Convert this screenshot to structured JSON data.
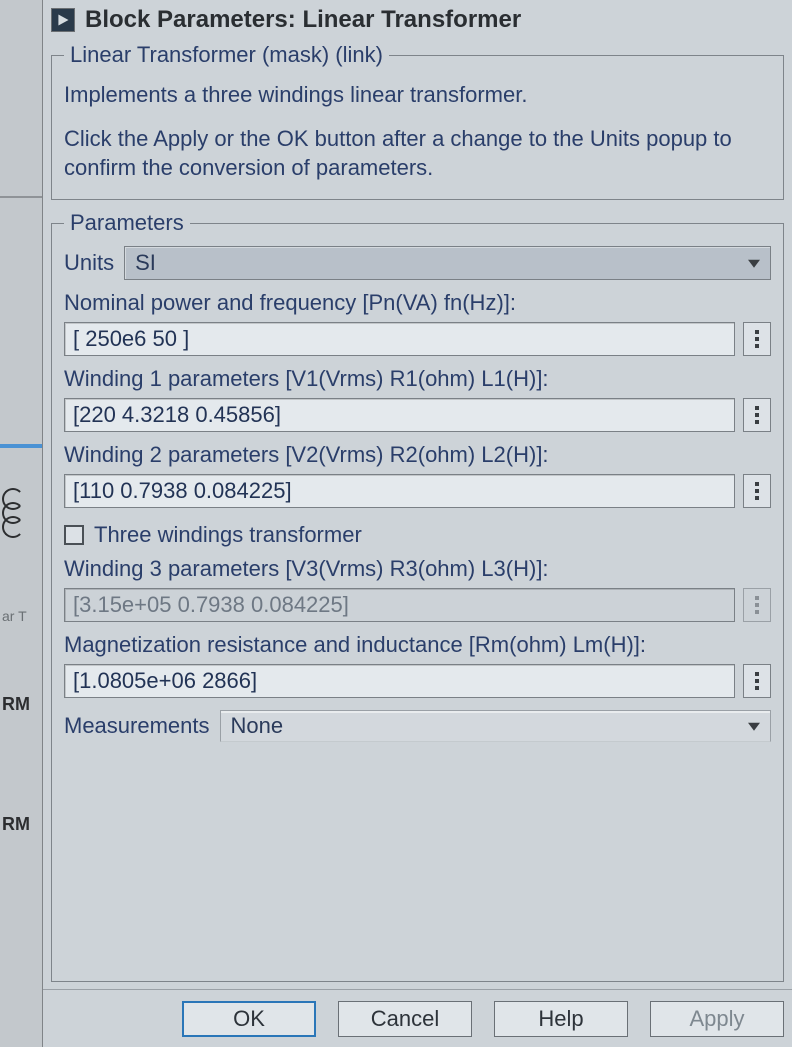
{
  "title": "Block Parameters: Linear Transformer",
  "mask": {
    "legend": "Linear Transformer (mask) (link)",
    "desc1": "Implements a three windings linear transformer.",
    "desc2": "Click the Apply or the OK button after a change to the Units popup to confirm the conversion of parameters."
  },
  "parameters_legend": "Parameters",
  "units": {
    "label": "Units",
    "value": "SI"
  },
  "fields": {
    "nominal": {
      "label": "Nominal power and frequency [Pn(VA) fn(Hz)]:",
      "value": "[ 250e6 50 ]"
    },
    "w1": {
      "label": "Winding 1 parameters [V1(Vrms) R1(ohm) L1(H)]:",
      "value": "[220 4.3218 0.45856]"
    },
    "w2": {
      "label": "Winding 2 parameters [V2(Vrms) R2(ohm) L2(H)]:",
      "value": "[110 0.7938 0.084225]"
    },
    "three_windings_label": "Three windings transformer",
    "w3": {
      "label": "Winding 3 parameters [V3(Vrms) R3(ohm) L3(H)]:",
      "value": "[3.15e+05 0.7938 0.084225]"
    },
    "mag": {
      "label": "Magnetization resistance and inductance [Rm(ohm) Lm(H)]:",
      "value": "[1.0805e+06 2866]"
    }
  },
  "measurements": {
    "label": "Measurements",
    "value": "None"
  },
  "buttons": {
    "ok": "OK",
    "cancel": "Cancel",
    "help": "Help",
    "apply": "Apply"
  },
  "bg": {
    "label1": "ar T",
    "label2": "RM",
    "label3": "RM"
  }
}
